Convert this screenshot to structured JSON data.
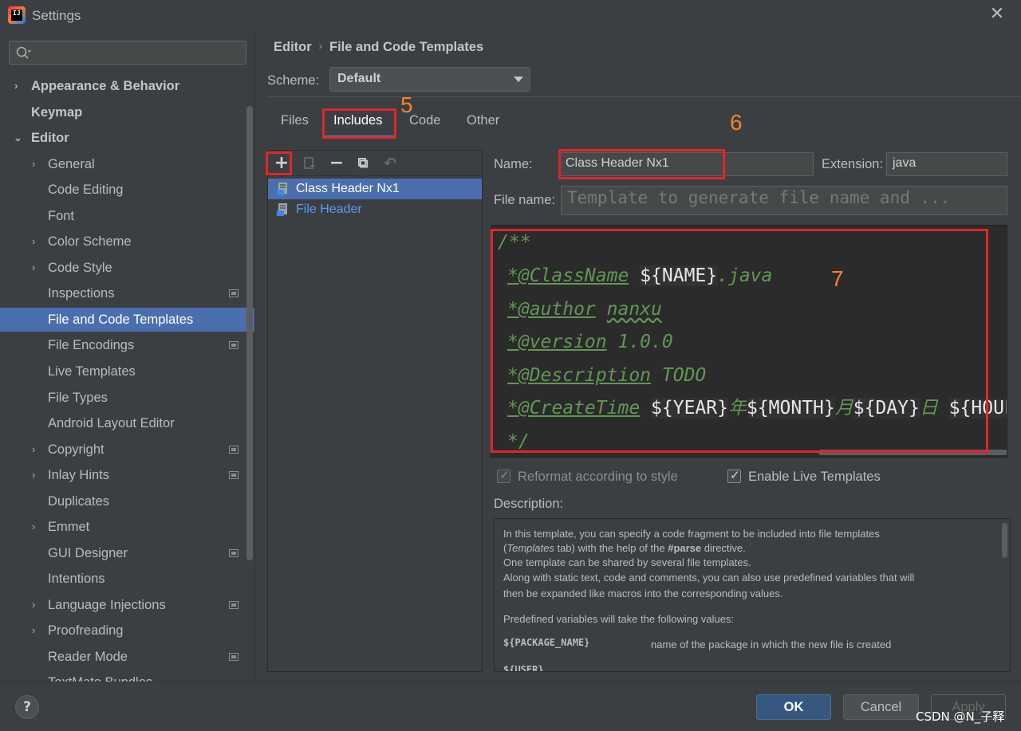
{
  "window": {
    "title": "Settings",
    "close_icon": "close-icon"
  },
  "sidebar": {
    "search_placeholder": "",
    "items": [
      {
        "label": "Appearance & Behavior",
        "chevron": ">"
      },
      {
        "label": "Keymap"
      },
      {
        "label": "Editor",
        "chevron": "v"
      },
      {
        "label": "General",
        "chevron": ">"
      },
      {
        "label": "Code Editing"
      },
      {
        "label": "Font"
      },
      {
        "label": "Color Scheme",
        "chevron": ">"
      },
      {
        "label": "Code Style",
        "chevron": ">"
      },
      {
        "label": "Inspections"
      },
      {
        "label": "File and Code Templates"
      },
      {
        "label": "File Encodings"
      },
      {
        "label": "Live Templates"
      },
      {
        "label": "File Types"
      },
      {
        "label": "Android Layout Editor"
      },
      {
        "label": "Copyright",
        "chevron": ">"
      },
      {
        "label": "Inlay Hints",
        "chevron": ">"
      },
      {
        "label": "Duplicates"
      },
      {
        "label": "Emmet",
        "chevron": ">"
      },
      {
        "label": "GUI Designer"
      },
      {
        "label": "Intentions"
      },
      {
        "label": "Language Injections",
        "chevron": ">"
      },
      {
        "label": "Proofreading",
        "chevron": ">"
      },
      {
        "label": "Reader Mode"
      },
      {
        "label": "TextMate Bundles"
      }
    ]
  },
  "breadcrumb": {
    "root": "Editor",
    "separator": "›",
    "current": "File and Code Templates"
  },
  "scheme": {
    "label": "Scheme:",
    "value": "Default"
  },
  "tabs": [
    {
      "label": "Files"
    },
    {
      "label": "Includes"
    },
    {
      "label": "Code"
    },
    {
      "label": "Other"
    }
  ],
  "annotations": {
    "five": "5",
    "six": "6",
    "seven": "7"
  },
  "toolbar": {
    "add": "+",
    "remove": "−",
    "copy": "⧉",
    "reset": "↶"
  },
  "templates": [
    {
      "label": "Class Header Nx1"
    },
    {
      "label": "File Header"
    }
  ],
  "editor": {
    "name_label": "Name:",
    "name_value": "Class Header Nx1",
    "extension_label": "Extension:",
    "extension_value": "java",
    "filename_label": "File name:",
    "filename_placeholder": "Template to generate file name and ...",
    "code": {
      "l1": "/**",
      "l2_tag": "*@ClassName",
      "l2_var": "${NAME}",
      "l2_rest": ".java",
      "l3_tag": "*@author",
      "l3_rest": "nanxu",
      "l4_tag": "*@version",
      "l4_rest": "1.0.0",
      "l5_tag": "*@Description",
      "l5_rest": "TODO",
      "l6_tag": "*@CreateTime",
      "l6_v1": "${YEAR}",
      "l6_s1": "年",
      "l6_v2": "${MONTH}",
      "l6_s2": "月",
      "l6_v3": "${DAY}",
      "l6_s3": "日",
      "l6_v4": "${HOUF",
      "l7": "*/"
    },
    "reformat_label": "Reformat according to style",
    "live_templates_label": "Enable Live Templates",
    "description_label": "Description:"
  },
  "description": {
    "d1": "In this template, you can specify a code fragment to be included into file templates",
    "d2a": "(",
    "d2b": "Templates",
    "d2c": " tab) with the help of the ",
    "d2d": "#parse",
    "d2e": " directive.",
    "d3": "One template can be shared by several file templates.",
    "d4": "Along with static text, code and comments, you can also use predefined variables that will",
    "d5": "then be expanded like macros into the corresponding values.",
    "d6": "Predefined variables will take the following values:",
    "v1_name": "${PACKAGE_NAME}",
    "v1_desc": "name of the package in which the new file is created",
    "v2_name": "${USER}"
  },
  "buttons": {
    "help": "?",
    "ok": "OK",
    "cancel": "Cancel",
    "apply": "Apply"
  },
  "watermark": "CSDN @N_子释",
  "colors": {
    "selection": "#4b6eaf",
    "accent_red": "#e0262b",
    "annotation": "#f5822a",
    "link": "#589df6"
  }
}
